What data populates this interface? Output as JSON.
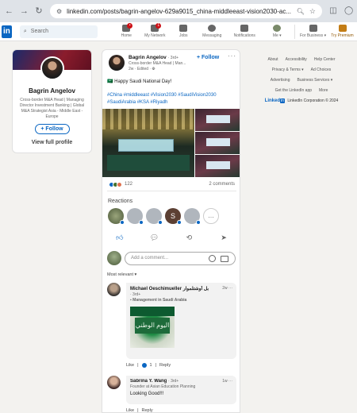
{
  "browser": {
    "url": "linkedin.com/posts/bagrin-angelov-629a9015_china-middleeast-vision2030-ac..."
  },
  "nav": {
    "logo": "in",
    "search_placeholder": "Search",
    "items": [
      {
        "label": "Home",
        "badge": ""
      },
      {
        "label": "My Network",
        "badge": ""
      },
      {
        "label": "Jobs",
        "badge": ""
      },
      {
        "label": "Messaging",
        "badge": ""
      },
      {
        "label": "Notifications",
        "badge": ""
      },
      {
        "label": "Me ▾",
        "badge": ""
      }
    ],
    "business": "For Business ▾",
    "premium": "Try Premium"
  },
  "profile": {
    "name": "Bagrin Angelov",
    "headline": "Cross-border M&A Head | Managing Director Investment Banking | Global M&A Strategist Asia - Middle East - Europe",
    "follow": "+ Follow",
    "view": "View full profile"
  },
  "post": {
    "author": "Bagrin Angelov",
    "degree": "· 3rd+",
    "subtitle": "Cross-border M&A Head | Man...",
    "time": "2w · Edited · ",
    "follow": "+ Follow",
    "line1": "🇸🇦 Happy Saudi National Day!",
    "hashtags": "#China #middleeast #Vision2030 #SaudiVision2030 #SaudiArabia #KSA #Riyadh",
    "reactions_count": "122",
    "comments_count": "2 comments",
    "reactions_heading": "Reactions",
    "comment_placeholder": "Add a comment...",
    "sort": "Most relevant ▾"
  },
  "comments": [
    {
      "name": "Michael Oeschimueller بل أوشتلموار",
      "degree": "· 3rd+",
      "desc": "Management in Saudi Arabia",
      "time": "2w ···",
      "text": "",
      "image_text": "اليوم الوطني",
      "like": "Like",
      "like_count": "1",
      "reply": "Reply"
    },
    {
      "name": "Sabrina Y. Wang",
      "degree": "· 3rd+",
      "desc": "Founder at Asian Education Planning",
      "time": "1w ···",
      "text": "Looking Good!!!",
      "like": "Like",
      "reply": "Reply"
    }
  ],
  "footer": {
    "row1": [
      "About",
      "Accessibility",
      "Help Center"
    ],
    "row2": [
      "Privacy & Terms ▾",
      "Ad Choices"
    ],
    "row3": [
      "Advertising",
      "Business Services ▾"
    ],
    "row4": [
      "Get the LinkedIn app",
      "More"
    ],
    "brand": "Linked",
    "copyright": "LinkedIn Corporation © 2024"
  }
}
